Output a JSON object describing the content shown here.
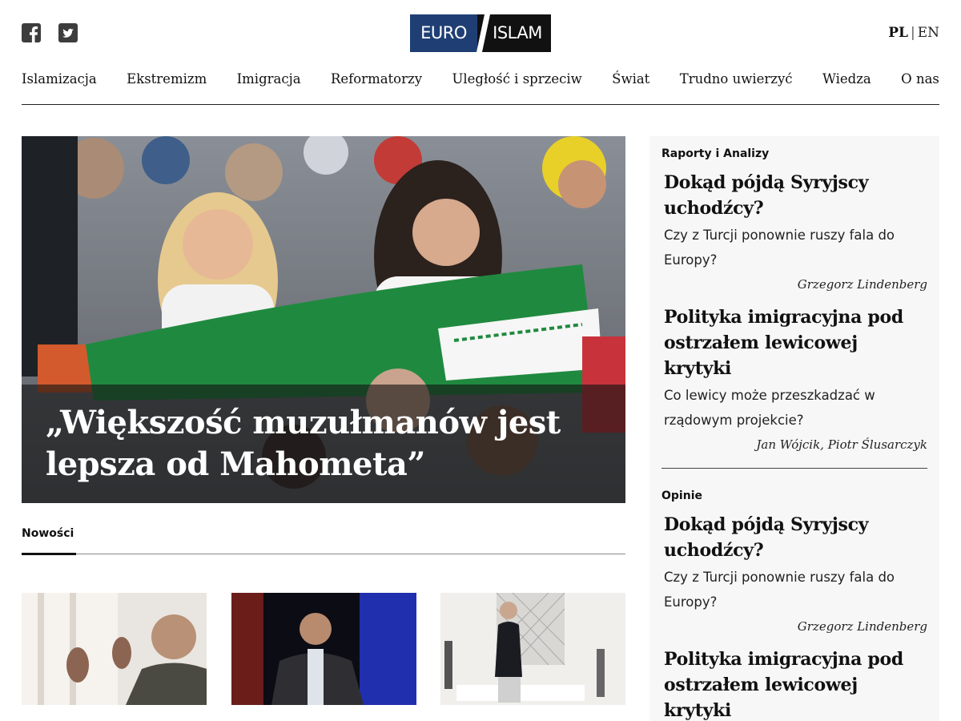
{
  "header": {
    "logo_left": "EURO",
    "logo_right": "ISLAM",
    "lang_active": "PL",
    "lang_separator": "|",
    "lang_other": "EN",
    "social_icons": [
      "facebook-icon",
      "twitter-icon"
    ]
  },
  "nav": {
    "items": [
      {
        "label": "Islamizacja"
      },
      {
        "label": "Ekstremizm"
      },
      {
        "label": "Imigracja"
      },
      {
        "label": "Reformatorzy"
      },
      {
        "label": "Uległość i sprzeciw"
      },
      {
        "label": "Świat"
      },
      {
        "label": "Trudno uwierzyć"
      },
      {
        "label": "Wiedza"
      },
      {
        "label": "O nas"
      }
    ]
  },
  "hero": {
    "title": "„Większość muzułmanów jest lepsza od Mahometa”"
  },
  "news": {
    "label": "Nowości"
  },
  "sidebar": {
    "sections": [
      {
        "title": "Raporty i Analizy",
        "articles": [
          {
            "title": "Dokąd pójdą Syryjscy uchodźcy?",
            "lead": "Czy z Turcji ponownie ruszy fala do Europy?",
            "author": "Grzegorz Lindenberg"
          },
          {
            "title": "Polityka imigracyjna pod ostrzałem lewicowej krytyki",
            "lead": "Co lewicy może przeszkadzać w rządowym projekcie?",
            "author": "Jan Wójcik, Piotr Ślusarczyk"
          }
        ]
      },
      {
        "title": "Opinie",
        "articles": [
          {
            "title": "Dokąd pójdą Syryjscy uchodźcy?",
            "lead": "Czy z Turcji ponownie ruszy fala do Europy?",
            "author": "Grzegorz Lindenberg"
          },
          {
            "title": "Polityka imigracyjna pod ostrzałem lewicowej krytyki",
            "lead": "",
            "author": ""
          }
        ]
      }
    ]
  },
  "colors": {
    "logo_blue": "#1f3f74",
    "logo_black": "#111111",
    "sidebar_bg": "#f7f7f7"
  }
}
